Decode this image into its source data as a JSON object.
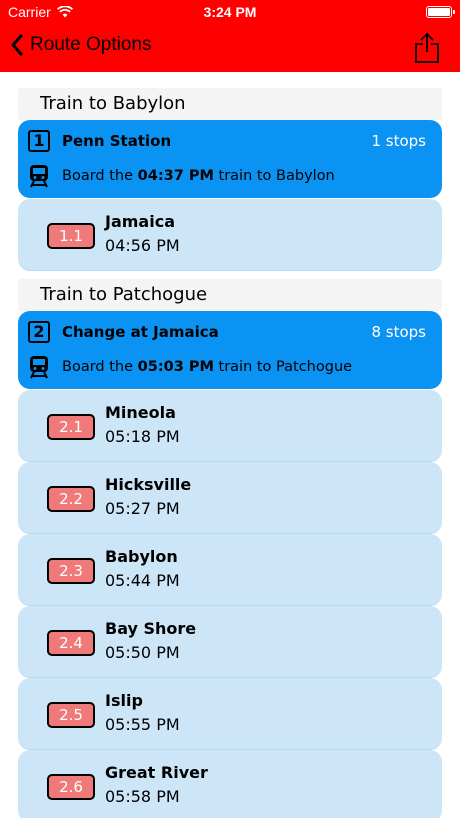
{
  "status_bar": {
    "carrier": "Carrier",
    "time": "3:24 PM"
  },
  "nav": {
    "back_label": "Route Options"
  },
  "sections": [
    {
      "header": "Train to Babylon",
      "leg_number": "1",
      "station": "Penn Station",
      "stops": "1 stops",
      "board_prefix": "Board the",
      "board_time": "04:37 PM",
      "board_suffix": "train to Babylon",
      "stop_list": [
        {
          "code": "1.1",
          "name": "Jamaica",
          "time": "04:56 PM"
        }
      ]
    },
    {
      "header": "Train to Patchogue",
      "leg_number": "2",
      "station": "Change at Jamaica",
      "stops": "8 stops",
      "board_prefix": "Board the",
      "board_time": "05:03 PM",
      "board_suffix": "train to Patchogue",
      "stop_list": [
        {
          "code": "2.1",
          "name": "Mineola",
          "time": "05:18 PM"
        },
        {
          "code": "2.2",
          "name": "Hicksville",
          "time": "05:27 PM"
        },
        {
          "code": "2.3",
          "name": "Babylon",
          "time": "05:44 PM"
        },
        {
          "code": "2.4",
          "name": "Bay Shore",
          "time": "05:50 PM"
        },
        {
          "code": "2.5",
          "name": "Islip",
          "time": "05:55 PM"
        },
        {
          "code": "2.6",
          "name": "Great River",
          "time": "05:58 PM"
        }
      ]
    }
  ],
  "colors": {
    "bar": "#ff0000",
    "leg": "#0a93f3",
    "stop": "#cce6f7",
    "badge": "#f07a7a"
  }
}
